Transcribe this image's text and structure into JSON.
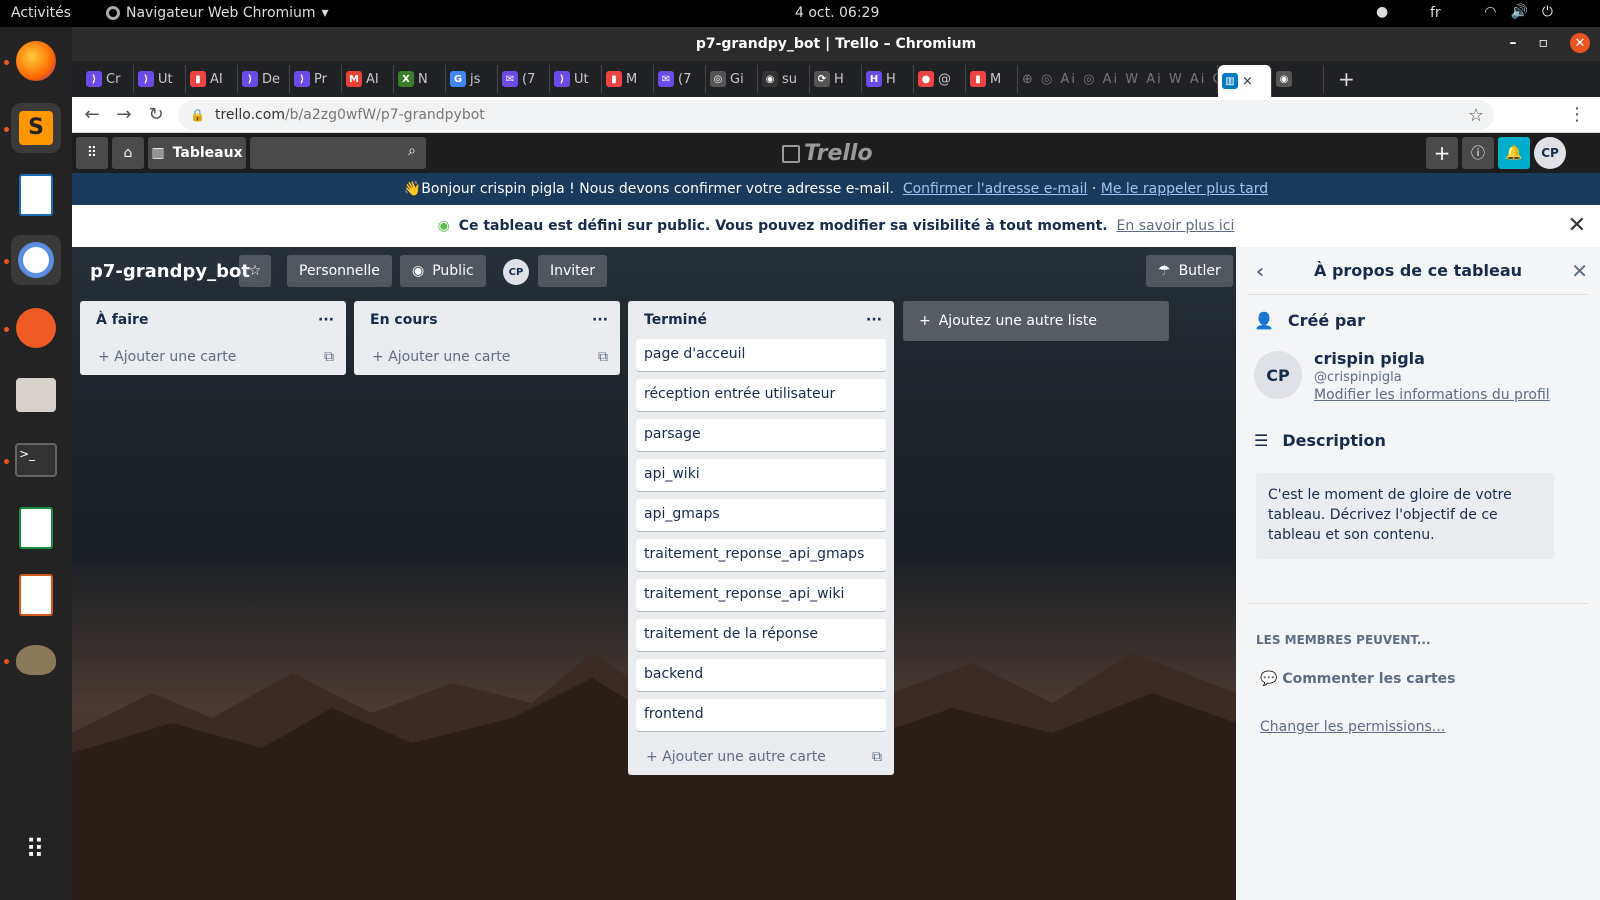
{
  "os": {
    "activities": "Activités",
    "app_name": "Navigateur Web Chromium",
    "clock": "4 oct.  06:29",
    "lang": "fr"
  },
  "browser": {
    "window_title": "p7-grandpy_bot | Trello – Chromium",
    "tabs": [
      "Cr",
      "Ut",
      "AI",
      "De",
      "Pr",
      "AI",
      "N",
      "js",
      "(7",
      "Ut",
      "M",
      "(7",
      "Gi",
      "su",
      "H",
      "H",
      "@",
      "M"
    ],
    "active_tab_close": "×",
    "url_host": "trello.com",
    "url_path": "/b/a2zg0wfW/p7-grandpybot"
  },
  "trello": {
    "boards_label": "Tableaux",
    "logo": "Trello",
    "avatar_initials": "CP"
  },
  "banner_email": {
    "text": "👋Bonjour crispin pigla ! Nous devons confirmer votre adresse e-mail.",
    "confirm": "Confirmer l'adresse e-mail",
    "sep": " · ",
    "later": "Me le rappeler plus tard"
  },
  "banner_public": {
    "text": "Ce tableau est défini sur public. Vous pouvez modifier sa visibilité à tout moment.",
    "link": "En savoir plus ici"
  },
  "board": {
    "title": "p7-grandpy_bot",
    "team": "Personnelle",
    "visibility": "Public",
    "member_initials": "CP",
    "invite": "Inviter",
    "butler": "Butler"
  },
  "lists": [
    {
      "name": "À faire",
      "add": "Ajouter une carte",
      "cards": []
    },
    {
      "name": "En cours",
      "add": "Ajouter une carte",
      "cards": []
    },
    {
      "name": "Terminé",
      "add": "Ajouter une autre carte",
      "cards": [
        "page d'acceuil",
        "réception entrée utilisateur",
        "parsage",
        "api_wiki",
        "api_gmaps",
        "traitement_reponse_api_gmaps",
        "traitement_reponse_api_wiki",
        "traitement de la réponse",
        "backend",
        "frontend"
      ]
    }
  ],
  "add_list": "Ajoutez une autre liste",
  "panel": {
    "title": "À propos de ce tableau",
    "created_by": "Créé par",
    "name": "crispin pigla",
    "handle": "@crispinpigla",
    "edit_profile": "Modifier les informations du profil",
    "description_label": "Description",
    "description": "C'est le moment de gloire de votre tableau. Décrivez l'objectif de ce tableau et son contenu.",
    "members_can": "LES MEMBRES PEUVENT...",
    "comment_cards": "Commenter les cartes",
    "change_perms": "Changer les permissions..."
  }
}
